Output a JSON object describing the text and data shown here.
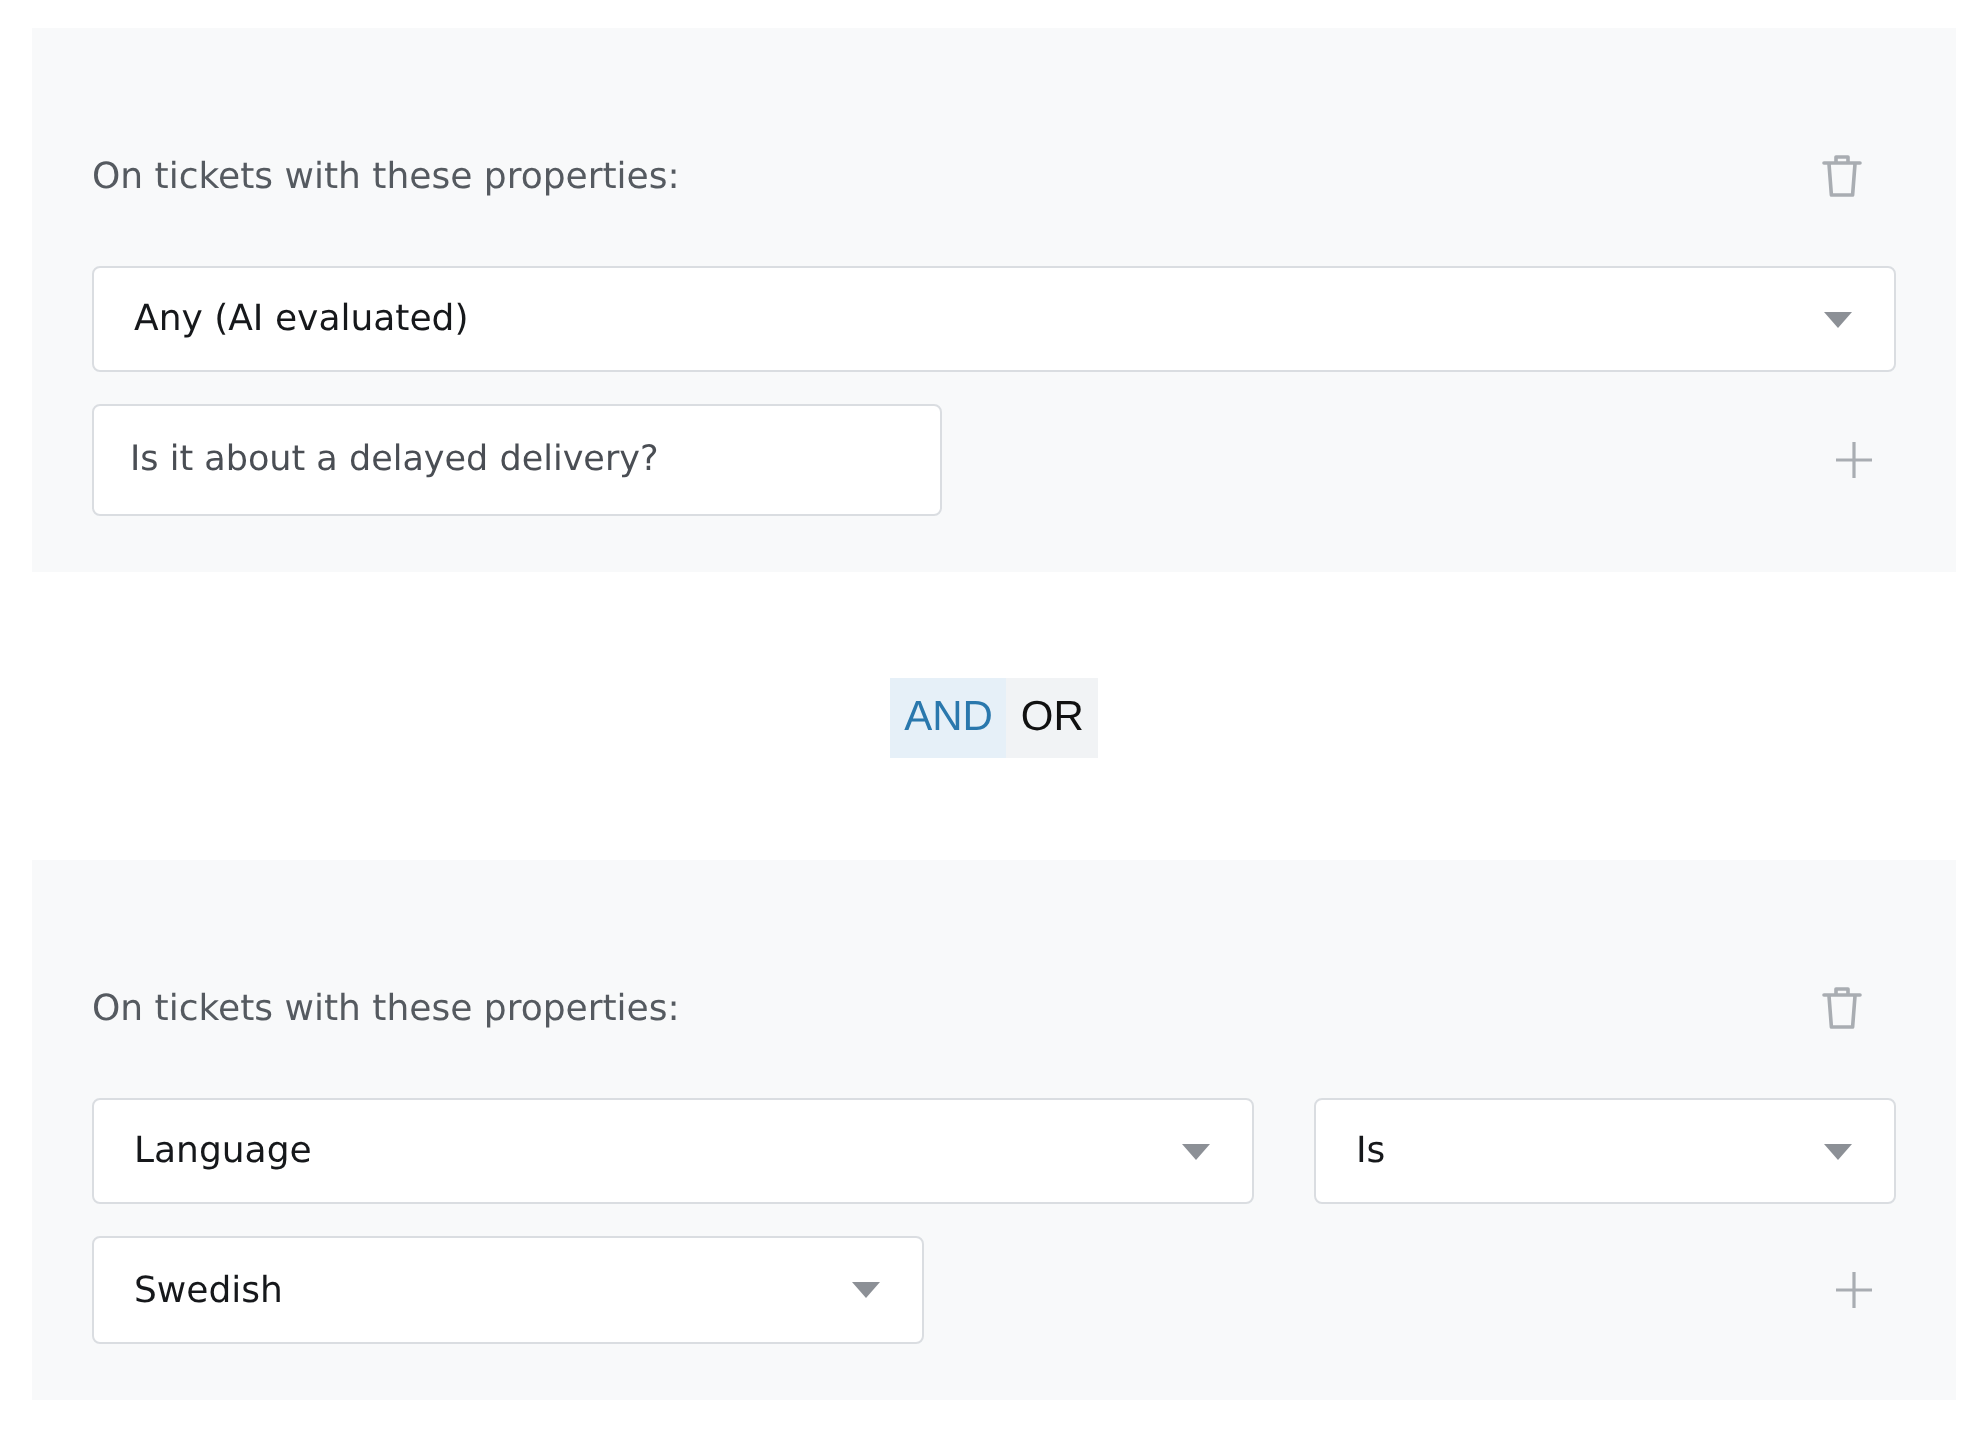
{
  "sections": [
    {
      "kind": "conditions",
      "label": "On tickets with these properties:",
      "property": "Any (AI evaluated)",
      "value": {
        "kind": "text",
        "text": "Is it about a delayed delivery?"
      }
    },
    {
      "kind": "logic_toggle",
      "options": [
        {
          "label": "AND",
          "selected": true
        },
        {
          "label": "OR",
          "selected": false
        }
      ]
    },
    {
      "kind": "conditions",
      "label": "On tickets with these properties:",
      "property": "Language",
      "operator": "Is",
      "value": {
        "kind": "dropdown",
        "text": "Swedish"
      }
    }
  ]
}
